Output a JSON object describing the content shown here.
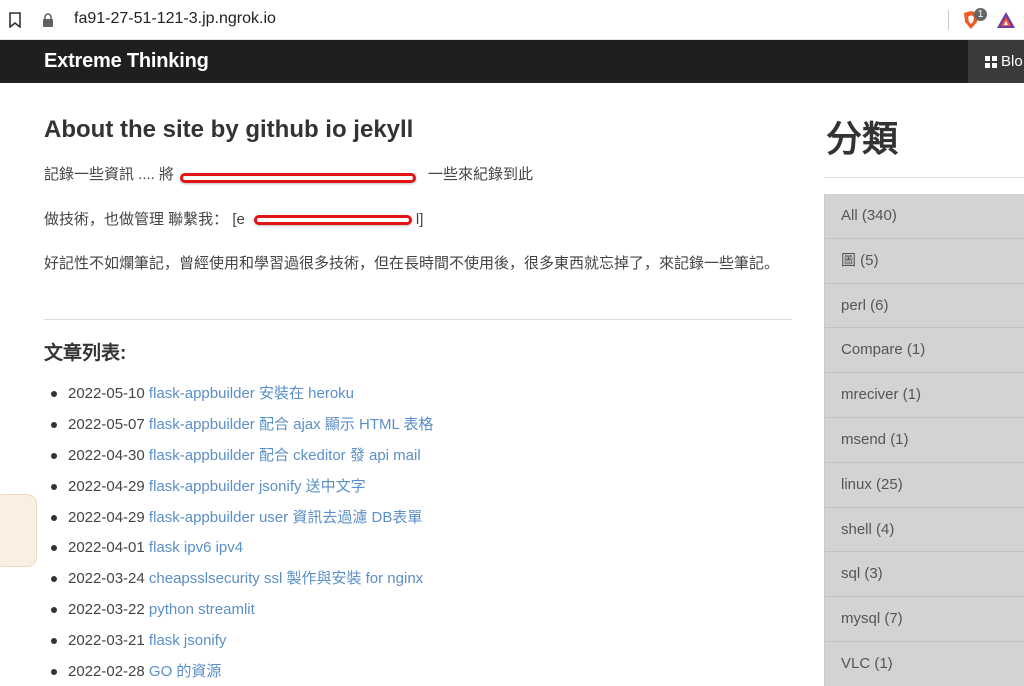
{
  "browser": {
    "url": "fa91-27-51-121-3.jp.ngrok.io",
    "brave_badge": "1",
    "icons": [
      "bookmark-icon",
      "lock-icon",
      "brave-shield-icon",
      "rewards-icon"
    ]
  },
  "navbar": {
    "brand": "Extreme Thinking",
    "right_label": "Blo",
    "right_icon": "grid-icon"
  },
  "main": {
    "title": "About the site by github io jekyll",
    "p1_before": "記錄一些資訊 .... 將",
    "p1_after": "一些來紀錄到此",
    "p2_before": "做技術，也做管理 聯繫我： [e",
    "p2_after": "l]",
    "p3": "好記性不如爛筆記，曾經使用和學習過很多技術，但在長時間不使用後，很多東西就忘掉了，來記錄一些筆記。",
    "list_title": "文章列表:",
    "posts": [
      {
        "date": "2022-05-10",
        "title": "flask-appbuilder 安裝在 heroku"
      },
      {
        "date": "2022-05-07",
        "title": "flask-appbuilder 配合 ajax 顯示 HTML 表格"
      },
      {
        "date": "2022-04-30",
        "title": "flask-appbuilder 配合 ckeditor 發 api mail"
      },
      {
        "date": "2022-04-29",
        "title": "flask-appbuilder jsonify 送中文字"
      },
      {
        "date": "2022-04-29",
        "title": "flask-appbuilder user 資訊去過濾 DB表單"
      },
      {
        "date": "2022-04-01",
        "title": "flask ipv6 ipv4"
      },
      {
        "date": "2022-03-24",
        "title": "cheapsslsecurity ssl 製作與安裝 for nginx"
      },
      {
        "date": "2022-03-22",
        "title": "python streamlit"
      },
      {
        "date": "2022-03-21",
        "title": "flask jsonify"
      },
      {
        "date": "2022-02-28",
        "title": "GO 的資源"
      }
    ]
  },
  "sidebar": {
    "title": "分類",
    "categories": [
      "All (340)",
      "圖 (5)",
      "perl (6)",
      "Compare (1)",
      "mreciver (1)",
      "msend (1)",
      "linux (25)",
      "shell (4)",
      "sql (3)",
      "mysql (7)",
      "VLC (1)"
    ]
  },
  "colors": {
    "navbar_bg": "#1f1f1f",
    "link": "#5b8fc7",
    "sidebar_item_bg": "#d3d3d3",
    "redaction": "#e01414"
  }
}
